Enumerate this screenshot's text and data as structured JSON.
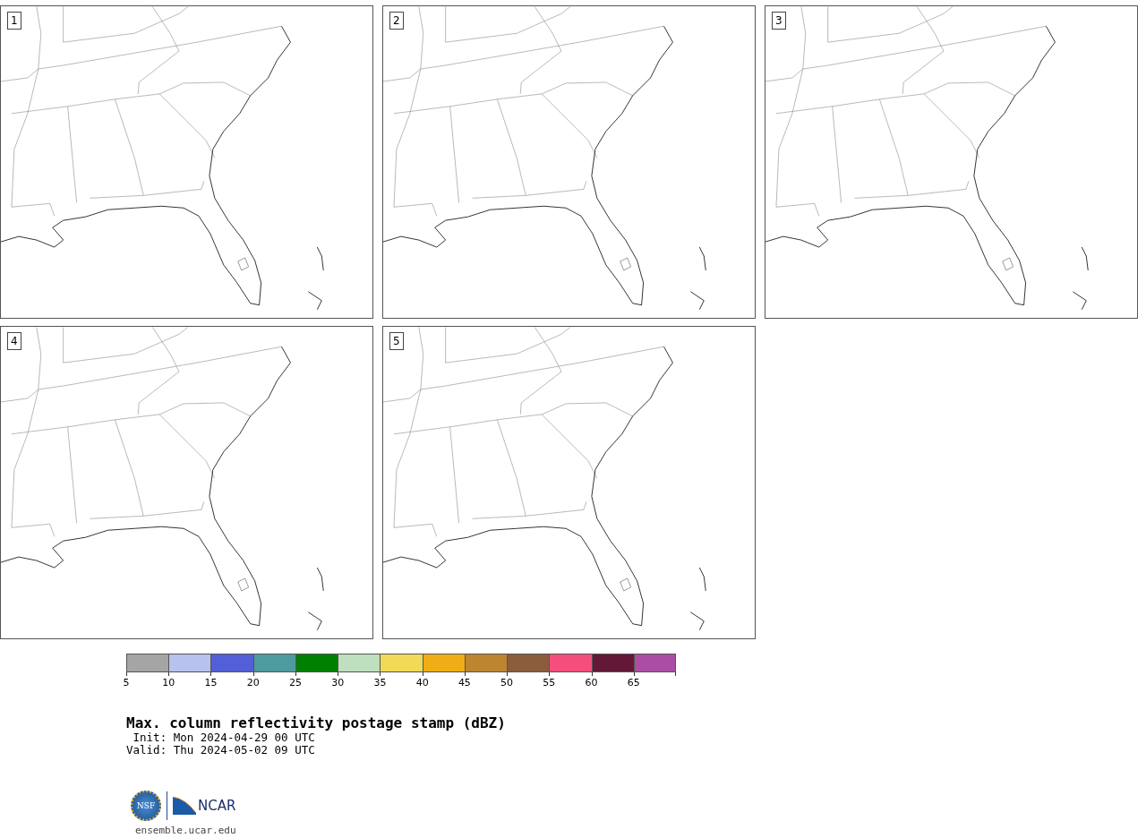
{
  "panels": [
    {
      "label": "1"
    },
    {
      "label": "2"
    },
    {
      "label": "3"
    },
    {
      "label": "4"
    },
    {
      "label": "5"
    }
  ],
  "colorbar": {
    "segments": [
      {
        "color": "#a5a5a5",
        "tick": "5"
      },
      {
        "color": "#b8c2ee",
        "tick": "10"
      },
      {
        "color": "#525fd6",
        "tick": "15"
      },
      {
        "color": "#4f9a9e",
        "tick": "20"
      },
      {
        "color": "#008000",
        "tick": "25"
      },
      {
        "color": "#bfdfbf",
        "tick": "30"
      },
      {
        "color": "#f0da58",
        "tick": "35"
      },
      {
        "color": "#f1ad16",
        "tick": "40"
      },
      {
        "color": "#bd8530",
        "tick": "45"
      },
      {
        "color": "#8c5c3e",
        "tick": "50"
      },
      {
        "color": "#f44f7c",
        "tick": "55"
      },
      {
        "color": "#641837",
        "tick": "60"
      },
      {
        "color": "#ac4da4",
        "tick": "65"
      }
    ]
  },
  "title": "Max. column reflectivity postage stamp (dBZ)",
  "init": " Init: Mon 2024-04-29 00 UTC",
  "valid": "Valid: Thu 2024-05-02 09 UTC",
  "logo": {
    "left": "NSF",
    "right": "NCAR"
  },
  "footer": "ensemble.ucar.edu"
}
